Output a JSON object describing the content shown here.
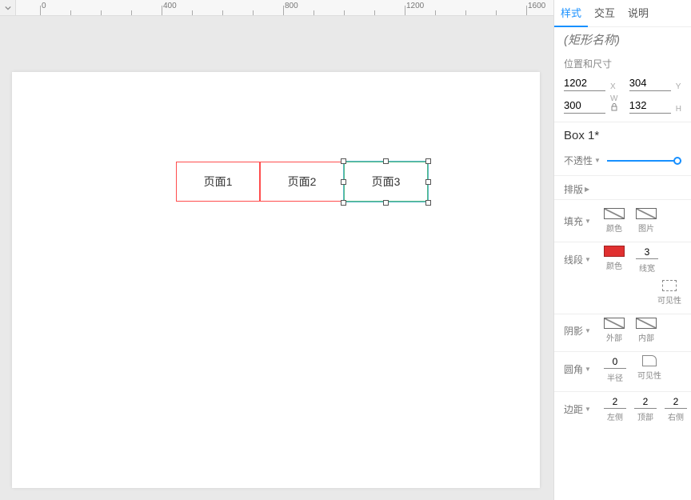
{
  "ruler": {
    "ticks": [
      0,
      400,
      800,
      1200,
      1600
    ]
  },
  "canvas": {
    "shapes": [
      {
        "label": "页面1",
        "selected": false
      },
      {
        "label": "页面2",
        "selected": false
      },
      {
        "label": "页面3",
        "selected": true
      }
    ]
  },
  "panel": {
    "tabs": {
      "style": "样式",
      "interact": "交互",
      "notes": "说明"
    },
    "name_placeholder": "(矩形名称)",
    "pos_section": "位置和尺寸",
    "pos": {
      "x": "1202",
      "y": "304",
      "w": "300",
      "h": "132",
      "xl": "X",
      "yl": "Y",
      "wl": "W",
      "hl": "H"
    },
    "style_name": "Box 1*",
    "opacity": {
      "label": "不透性",
      "value": "100"
    },
    "typo": "排版",
    "fill": {
      "label": "填充",
      "color": "颜色",
      "image": "图片"
    },
    "line": {
      "label": "线段",
      "color": "颜色",
      "width_label": "线宽",
      "width": "3",
      "vis": "可见性"
    },
    "shadow": {
      "label": "阴影",
      "outer": "外部",
      "inner": "内部"
    },
    "corner": {
      "label": "圆角",
      "radius_label": "半径",
      "radius": "0",
      "vis": "可见性"
    },
    "margin": {
      "label": "边距",
      "left": "2",
      "left_label": "左侧",
      "top": "2",
      "top_label": "顶部",
      "right": "2",
      "right_label": "右侧"
    }
  }
}
